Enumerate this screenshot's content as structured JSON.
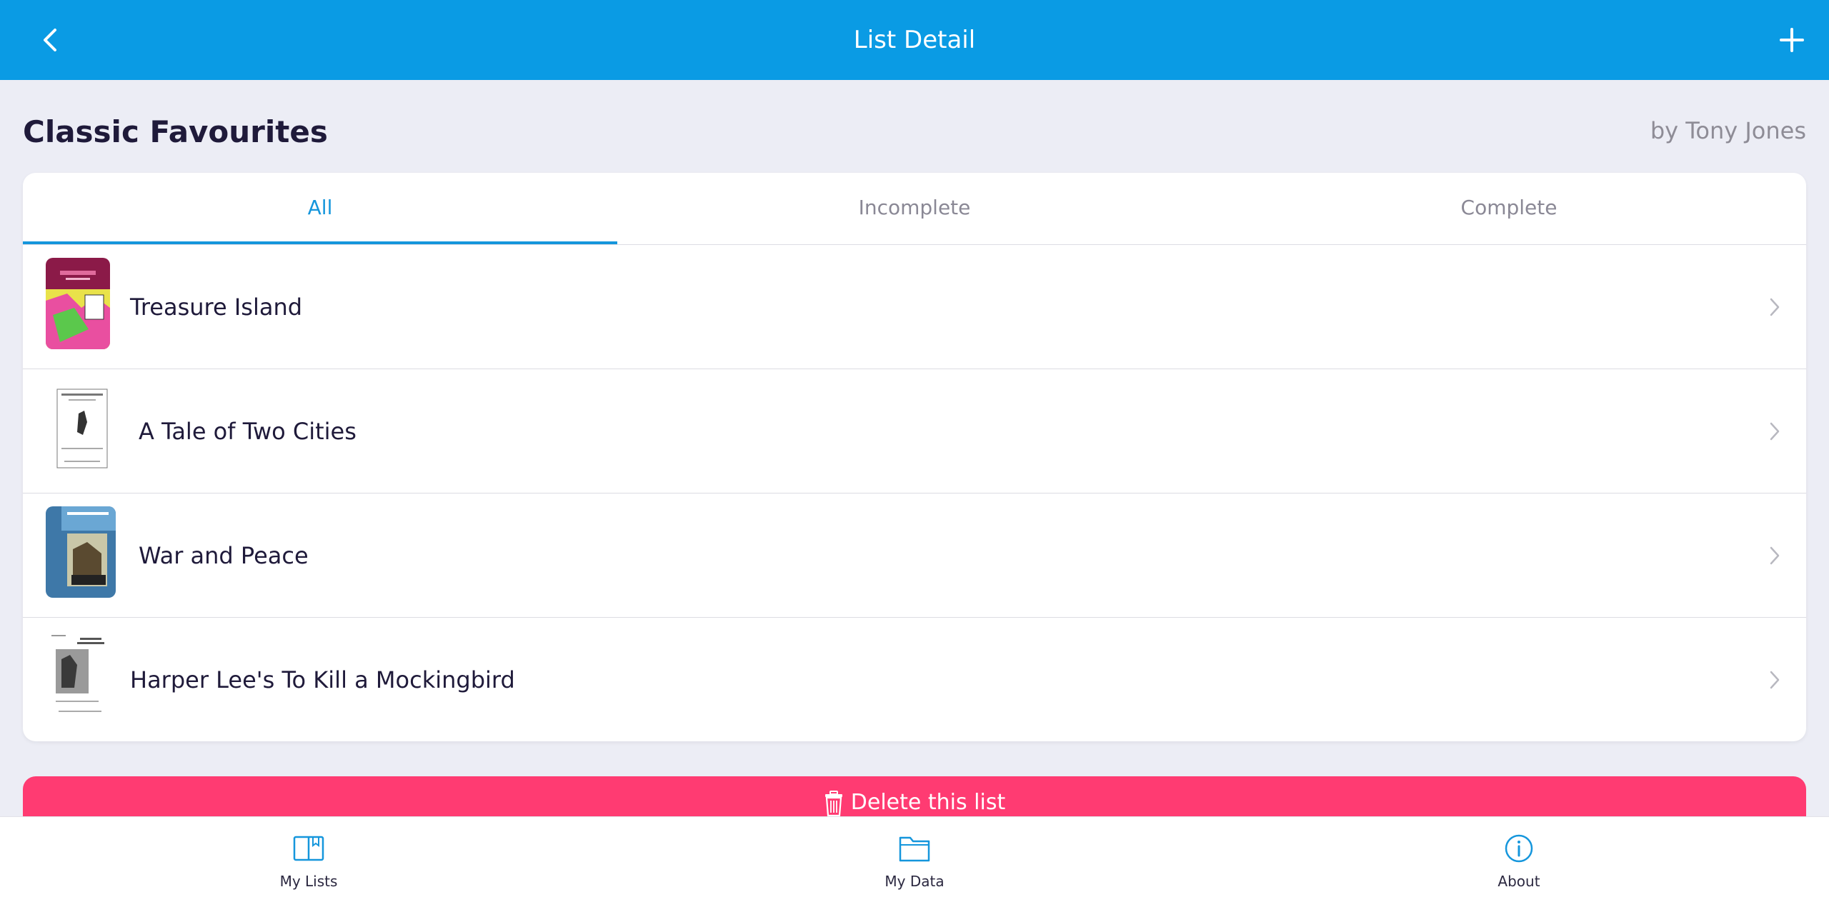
{
  "header": {
    "title": "List Detail",
    "back_icon": "chevron-left-icon",
    "add_icon": "plus-icon"
  },
  "list": {
    "title": "Classic Favourites",
    "author": "by Tony Jones"
  },
  "tabs": [
    {
      "label": "All",
      "active": true
    },
    {
      "label": "Incomplete",
      "active": false
    },
    {
      "label": "Complete",
      "active": false
    }
  ],
  "items": [
    {
      "title": "Treasure Island",
      "cover": "book-cover-treasure-island"
    },
    {
      "title": "A Tale of Two Cities",
      "cover": "book-cover-tale-of-two-cities"
    },
    {
      "title": "War and Peace",
      "cover": "book-cover-war-and-peace"
    },
    {
      "title": "Harper Lee's To Kill a Mockingbird",
      "cover": "book-cover-to-kill-a-mockingbird"
    }
  ],
  "delete_button": {
    "label": "Delete this list",
    "icon": "trash-icon"
  },
  "bottom_nav": [
    {
      "label": "My Lists",
      "icon": "book-icon"
    },
    {
      "label": "My Data",
      "icon": "folder-icon"
    },
    {
      "label": "About",
      "icon": "info-icon"
    }
  ],
  "colors": {
    "primary": "#0A9BE4",
    "danger": "#FF3B72",
    "background": "#ECEDF5",
    "active_tab": "#1596DC"
  }
}
